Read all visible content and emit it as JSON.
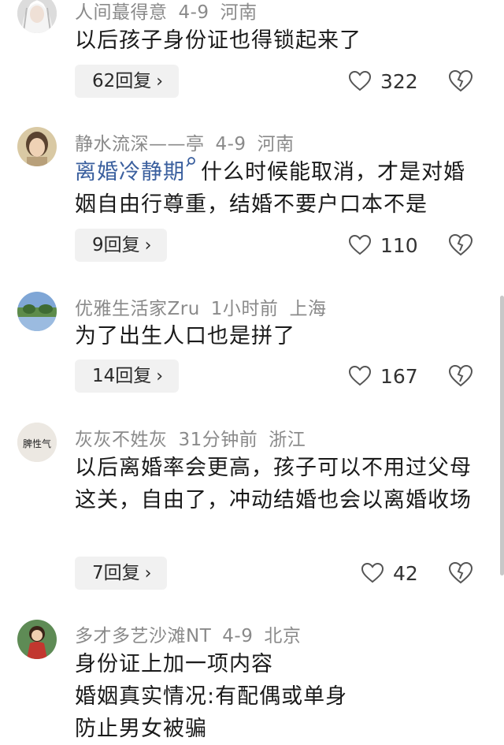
{
  "comments": [
    {
      "username": "人间蕞得意",
      "date": "4-9",
      "location": "河南",
      "text": "以后孩子身份证也得锁起来了",
      "reply_label": "62回复",
      "likes": "322",
      "avatar_icon": "white-hair-anime-avatar"
    },
    {
      "username": "静水流深——亭",
      "date": "4-9",
      "location": "河南",
      "tag": "离婚冷静期",
      "text": "什么时候能取消，才是对婚姻自由行尊重，结婚不要户口本不是",
      "reply_label": "9回复",
      "likes": "110",
      "avatar_icon": "girl-portrait-avatar"
    },
    {
      "username": "优雅生活家Zru",
      "date": "1小时前",
      "location": "上海",
      "text": "为了出生人口也是拼了",
      "reply_label": "14回复",
      "likes": "167",
      "avatar_icon": "landscape-avatar"
    },
    {
      "username": "灰灰不姓灰",
      "date": "31分钟前",
      "location": "浙江",
      "text": "以后离婚率会更高，孩子可以不用过父母这关，自由了，冲动结婚也会以离婚收场",
      "reply_label": "7回复",
      "likes": "42",
      "avatar_icon": "calligraphy-avatar",
      "avatar_text": "脾性气"
    },
    {
      "username": "多才多艺沙滩NT",
      "date": "4-9",
      "location": "北京",
      "text_lines": [
        "身份证上加一项内容",
        "婚姻真实情况:有配偶或单身",
        "防止男女被骗"
      ],
      "avatar_icon": "cartoon-girl-avatar"
    }
  ],
  "icons": {
    "like": "heart-outline-icon",
    "dislike": "broken-heart-icon",
    "reply_chevron": "chevron-right-icon",
    "tag_search": "search-icon"
  },
  "chevron": "›",
  "colors": {
    "meta": "#8a8a8a",
    "tag": "#3a5f9e",
    "reply_bg": "#f1f1f1"
  }
}
